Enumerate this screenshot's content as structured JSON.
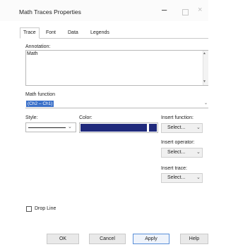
{
  "window": {
    "title": "Math Traces Properties",
    "minimize_glyph": "–",
    "close_glyph": "×"
  },
  "tabs": [
    "Trace",
    "Font",
    "Data",
    "Legends"
  ],
  "annotation": {
    "label": "Annotation:",
    "value": "Math"
  },
  "math_function": {
    "label": "Math function",
    "value": "(Ch2 – Ch1)"
  },
  "style": {
    "label": "Style:"
  },
  "color": {
    "label": "Color:",
    "value": "#202a7c"
  },
  "insert_function": {
    "label": "Insert function:",
    "value": "Select..."
  },
  "insert_operator": {
    "label": "Insert operator:",
    "value": "Select..."
  },
  "insert_trace": {
    "label": "Insert trace:",
    "value": "Select..."
  },
  "drop_line": {
    "label": "Drop Line",
    "checked": false
  },
  "buttons": {
    "ok": "OK",
    "cancel": "Cancel",
    "apply": "Apply",
    "help": "Help"
  },
  "icons": {
    "dropdown": "chevron-down-icon"
  }
}
